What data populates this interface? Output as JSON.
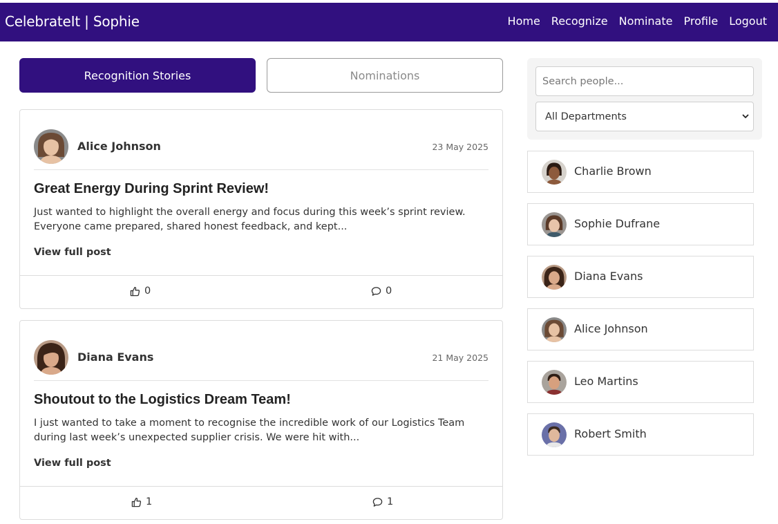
{
  "navbar": {
    "brand": "CelebrateIt | Sophie",
    "links": [
      "Home",
      "Recognize",
      "Nominate",
      "Profile",
      "Logout"
    ]
  },
  "tabs": {
    "active": "Recognition Stories",
    "inactive": "Nominations"
  },
  "posts": [
    {
      "author": "Alice Johnson",
      "date": "23 May 2025",
      "title": "Great Energy During Sprint Review!",
      "excerpt": "Just wanted to highlight the overall energy and focus during this week’s sprint review. Everyone came prepared, shared honest feedback, and kept...",
      "view_label": "View full post",
      "likes": "0",
      "comments": "0"
    },
    {
      "author": "Diana Evans",
      "date": "21 May 2025",
      "title": "Shoutout to the Logistics Dream Team!",
      "excerpt": "I just wanted to take a moment to recognise the incredible work of our Logistics Team during last week’s unexpected supplier crisis. We were hit with...",
      "view_label": "View full post",
      "likes": "1",
      "comments": "1"
    }
  ],
  "sidebar": {
    "search_placeholder": "Search people...",
    "department_selected": "All Departments",
    "people": [
      "Charlie Brown",
      "Sophie Dufrane",
      "Diana Evans",
      "Alice Johnson",
      "Leo Martins",
      "Robert Smith"
    ]
  },
  "colors": {
    "brand": "#31107f",
    "border": "#dcdcdc"
  },
  "icons": {
    "like": "thumbs-up-icon",
    "comment": "comment-icon",
    "select": "chevron-down-icon"
  }
}
